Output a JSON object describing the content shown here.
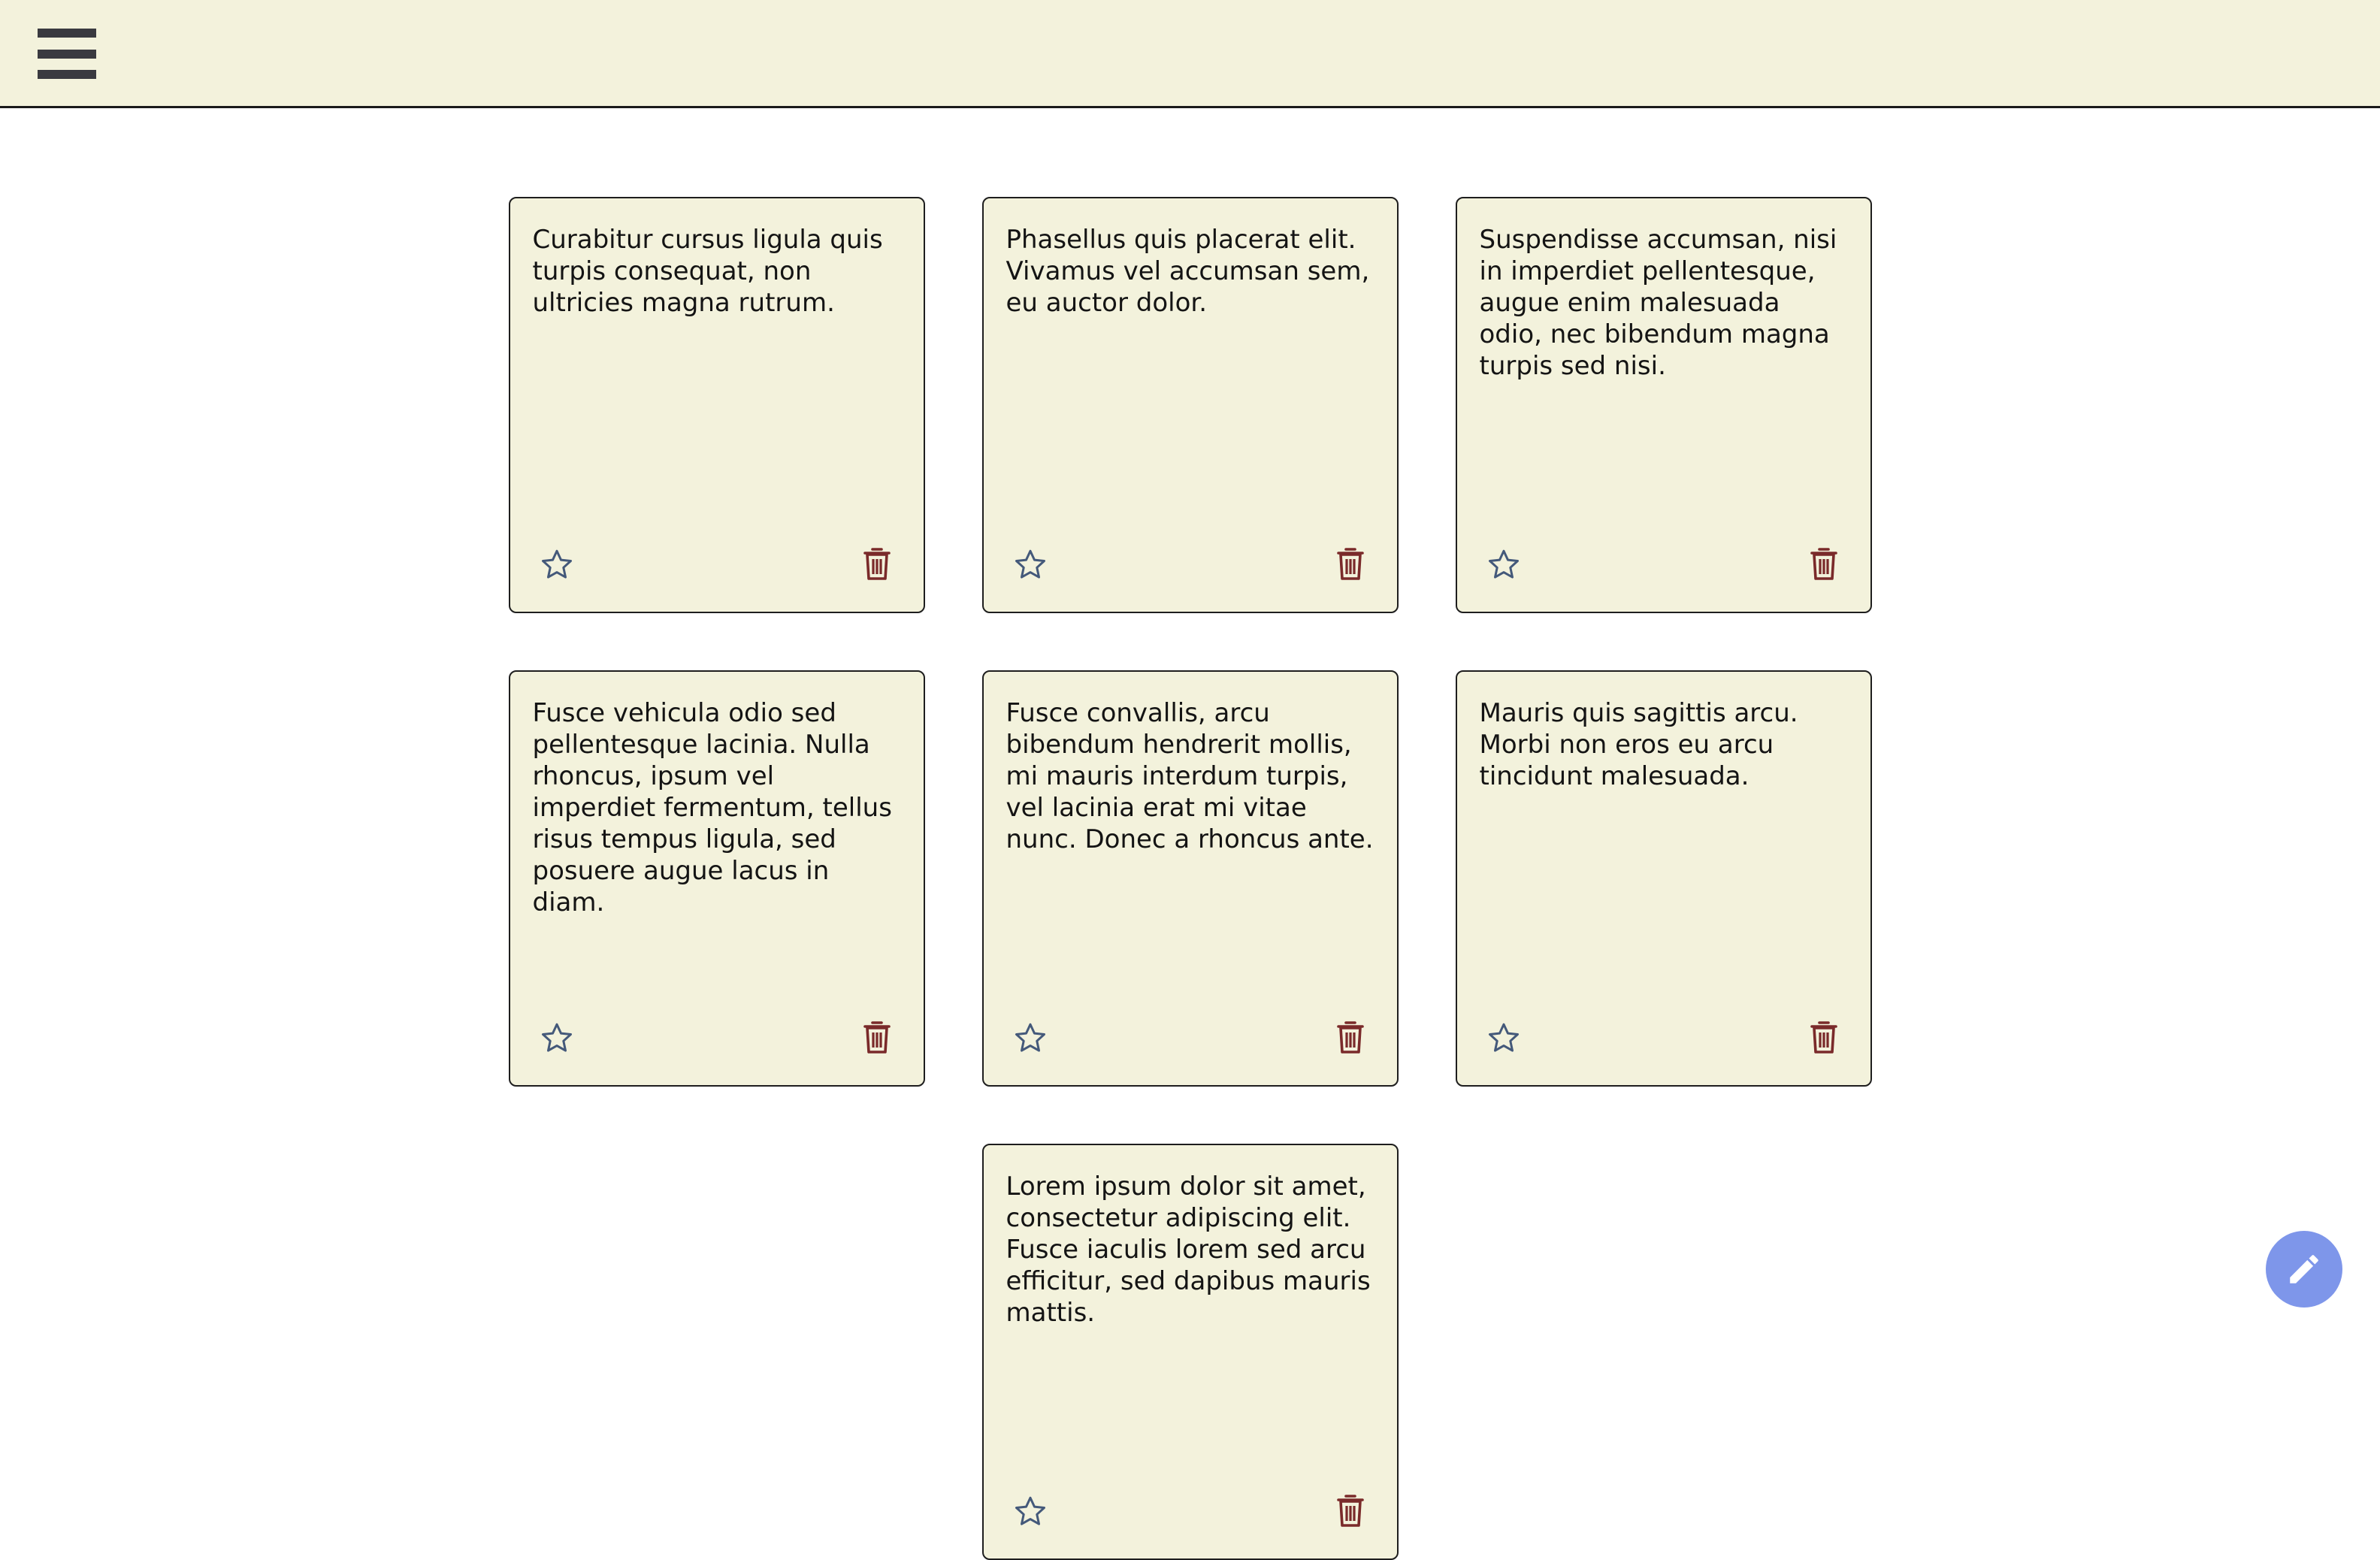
{
  "app": {
    "menu_icon": "hamburger-menu-icon",
    "colors": {
      "topbar_bg": "#f3f2dc",
      "note_bg": "#f3f2dc",
      "note_border": "#1e1e1e",
      "star_color": "#44597a",
      "trash_color": "#7a2a2a",
      "fab_bg": "#7e96ea"
    }
  },
  "notes": [
    {
      "text": "Curabitur cursus ligula quis turpis consequat, non ultricies magna rutrum.",
      "star_icon": "star-outline-icon",
      "delete_icon": "trash-icon"
    },
    {
      "text": "Phasellus quis placerat elit. Vivamus vel accumsan sem, eu auctor dolor.",
      "star_icon": "star-outline-icon",
      "delete_icon": "trash-icon"
    },
    {
      "text": "Suspendisse accumsan, nisi in imperdiet pellentesque, augue enim malesuada odio, nec bibendum magna turpis sed nisi.",
      "star_icon": "star-outline-icon",
      "delete_icon": "trash-icon"
    },
    {
      "text": "Fusce vehicula odio sed pellentesque lacinia. Nulla rhoncus, ipsum vel imperdiet fermentum, tellus risus tempus ligula, sed posuere augue lacus in diam.",
      "star_icon": "star-outline-icon",
      "delete_icon": "trash-icon"
    },
    {
      "text": "Fusce convallis, arcu bibendum hendrerit mollis, mi mauris interdum turpis, vel lacinia erat mi vitae nunc. Donec a rhoncus ante.",
      "star_icon": "star-outline-icon",
      "delete_icon": "trash-icon"
    },
    {
      "text": "Mauris quis sagittis arcu. Morbi non eros eu arcu tincidunt malesuada.",
      "star_icon": "star-outline-icon",
      "delete_icon": "trash-icon"
    },
    {
      "text": "Lorem ipsum dolor sit amet, consectetur adipiscing elit. Fusce iaculis lorem sed arcu efficitur, sed dapibus mauris mattis.",
      "star_icon": "star-outline-icon",
      "delete_icon": "trash-icon"
    }
  ],
  "fab": {
    "icon": "pencil-icon"
  }
}
